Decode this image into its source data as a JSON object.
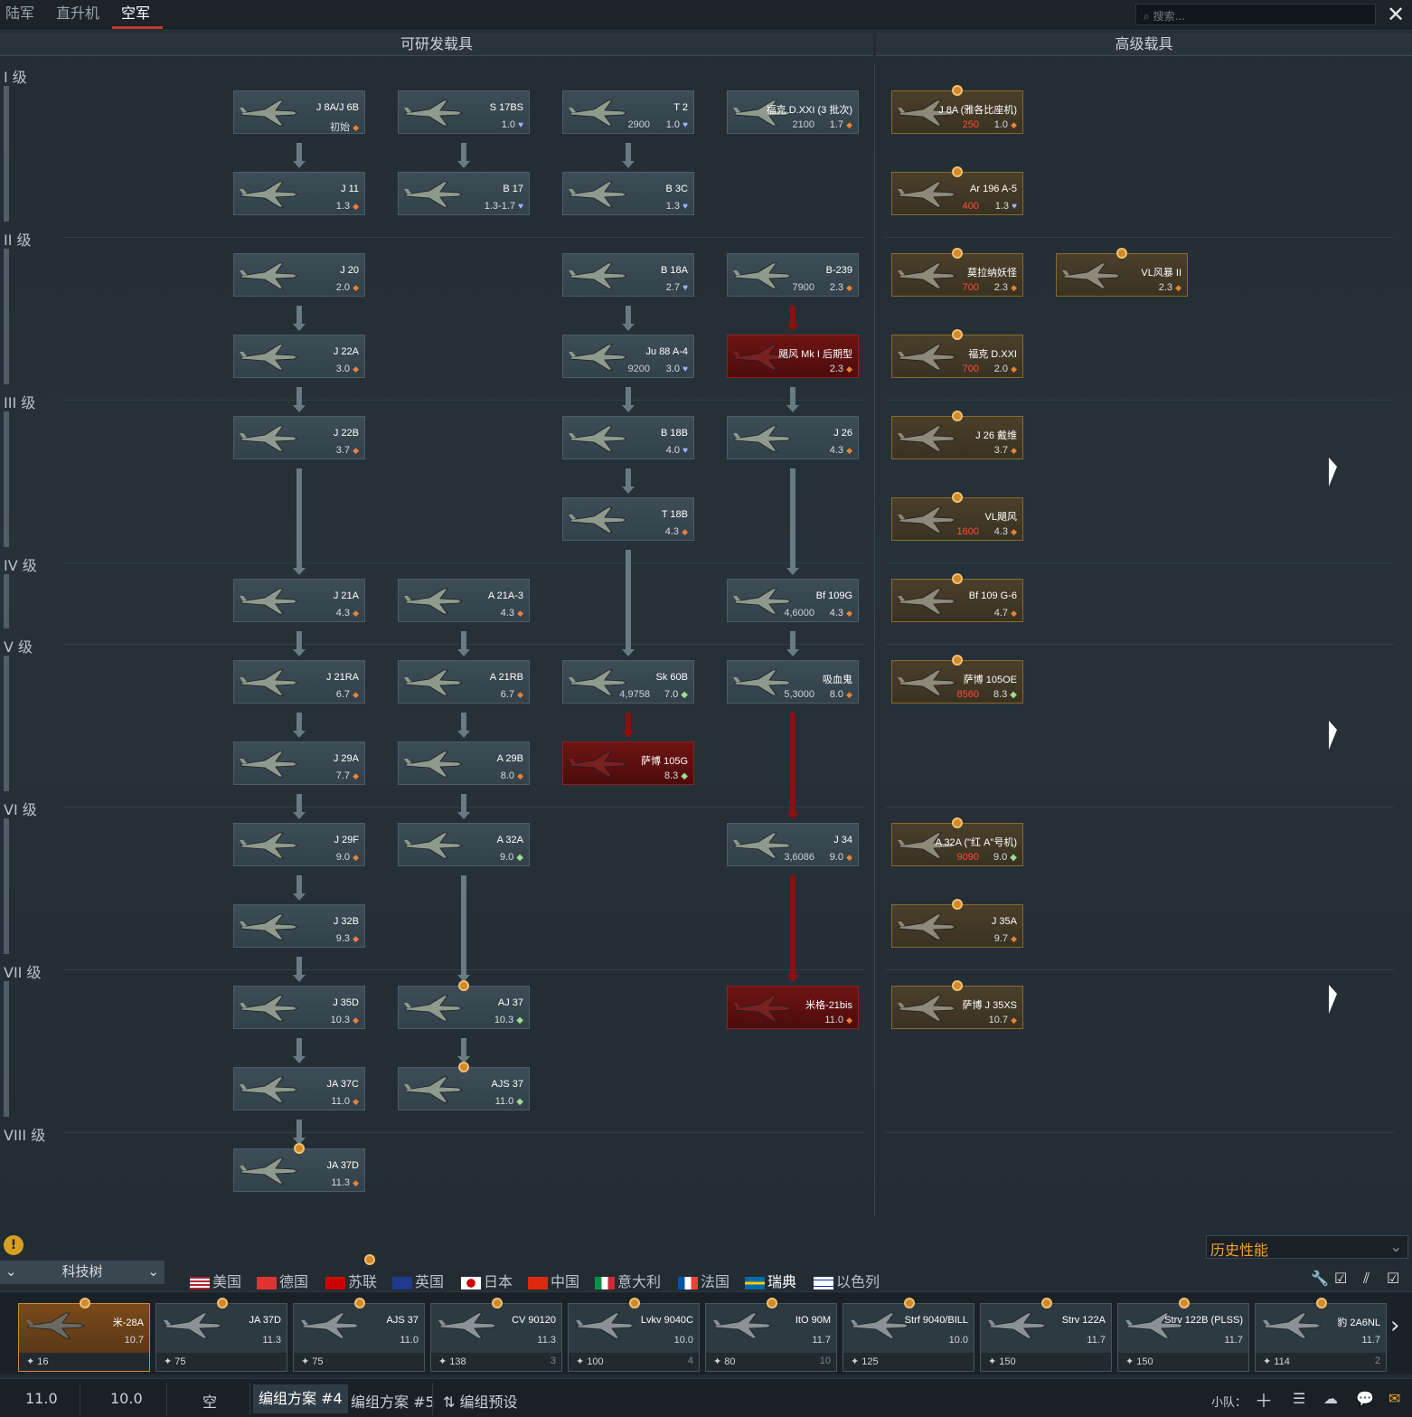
{
  "top_tabs": [
    "陆军",
    "直升机",
    "空军"
  ],
  "search": {
    "placeholder": "搜索..."
  },
  "close_icon": "close-icon",
  "headers": {
    "researchable": "可研发载具",
    "premium": "高级载具"
  },
  "ranks": [
    "I 级",
    "II 级",
    "III 级",
    "IV 级",
    "V 级",
    "VI 级",
    "VII 级",
    "VIII 级"
  ],
  "vehicles": [
    {
      "name": "J 8A/J 6B",
      "cost": "",
      "br": "初始",
      "icon": "dot"
    },
    {
      "name": "S 17BS",
      "cost": "",
      "br": "1.0",
      "icon": "blue"
    },
    {
      "name": "T 2",
      "cost": "2900",
      "br": "1.0",
      "icon": "blue"
    },
    {
      "name": "福克 D.XXI (3 批次)",
      "cost": "2100",
      "br": "1.7",
      "icon": "dot"
    },
    {
      "name": "J 8A (雅各比座机)",
      "cost": "250",
      "br": "1.0",
      "icon": "dot"
    },
    {
      "name": "J 11",
      "cost": "",
      "br": "1.3",
      "icon": "dot"
    },
    {
      "name": "B 17",
      "cost": "",
      "br": "1.3-1.7",
      "icon": "blue"
    },
    {
      "name": "B 3C",
      "cost": "",
      "br": "1.3",
      "icon": "blue"
    },
    {
      "name": "Ar 196 A-5",
      "cost": "400",
      "br": "1.3",
      "icon": "blue"
    },
    {
      "name": "J 20",
      "cost": "",
      "br": "2.0",
      "icon": "dot"
    },
    {
      "name": "B 18A",
      "cost": "",
      "br": "2.7",
      "icon": "blue"
    },
    {
      "name": "B-239",
      "cost": "7900",
      "br": "2.3",
      "icon": "dot"
    },
    {
      "name": "莫拉纳妖怪",
      "cost": "700",
      "br": "2.3",
      "icon": "dot"
    },
    {
      "name": "VL风暴 II",
      "cost": "",
      "br": "2.3",
      "icon": "dot"
    },
    {
      "name": "J 22A",
      "cost": "",
      "br": "3.0",
      "icon": "dot"
    },
    {
      "name": "Ju 88 A-4",
      "cost": "9200",
      "br": "3.0",
      "icon": "blue"
    },
    {
      "name": "飓风 Mk I 后期型",
      "cost": "",
      "br": "2.3",
      "icon": "dot"
    },
    {
      "name": "福克 D.XXI",
      "cost": "700",
      "br": "2.0",
      "icon": "dot"
    },
    {
      "name": "J 22B",
      "cost": "",
      "br": "3.7",
      "icon": "dot"
    },
    {
      "name": "B 18B",
      "cost": "",
      "br": "4.0",
      "icon": "blue"
    },
    {
      "name": "J 26",
      "cost": "",
      "br": "4.3",
      "icon": "dot"
    },
    {
      "name": "J 26 戴维",
      "cost": "",
      "br": "3.7",
      "icon": "dot"
    },
    {
      "name": "T 18B",
      "cost": "",
      "br": "4.3",
      "icon": "dot"
    },
    {
      "name": "VL飓风",
      "cost": "1600",
      "br": "4.3",
      "icon": "dot"
    },
    {
      "name": "J 21A",
      "cost": "",
      "br": "4.3",
      "icon": "dot"
    },
    {
      "name": "A 21A-3",
      "cost": "",
      "br": "4.3",
      "icon": "dot"
    },
    {
      "name": "Bf 109G",
      "cost": "4,6000",
      "br": "4.3",
      "icon": "dot"
    },
    {
      "name": "Bf 109 G-6",
      "cost": "",
      "br": "4.7",
      "icon": "dot"
    },
    {
      "name": "J 21RA",
      "cost": "",
      "br": "6.7",
      "icon": "dot"
    },
    {
      "name": "A 21RB",
      "cost": "",
      "br": "6.7",
      "icon": "dot"
    },
    {
      "name": "Sk 60B",
      "cost": "4,9758",
      "br": "7.0",
      "icon": "green"
    },
    {
      "name": "吸血鬼",
      "cost": "5,3000",
      "br": "8.0",
      "icon": "dot"
    },
    {
      "name": "萨博 105OE",
      "cost": "8560",
      "br": "8.3",
      "icon": "green"
    },
    {
      "name": "J 29A",
      "cost": "",
      "br": "7.7",
      "icon": "dot"
    },
    {
      "name": "A 29B",
      "cost": "",
      "br": "8.0",
      "icon": "dot"
    },
    {
      "name": "萨博 105G",
      "cost": "",
      "br": "8.3",
      "icon": "green"
    },
    {
      "name": "J 29F",
      "cost": "",
      "br": "9.0",
      "icon": "dot"
    },
    {
      "name": "A 32A",
      "cost": "",
      "br": "9.0",
      "icon": "green"
    },
    {
      "name": "J 34",
      "cost": "3,6086",
      "br": "9.0",
      "icon": "dot"
    },
    {
      "name": "A 32A (\"红 A\"号机)",
      "cost": "9090",
      "br": "9.0",
      "icon": "green"
    },
    {
      "name": "J 32B",
      "cost": "",
      "br": "9.3",
      "icon": "dot"
    },
    {
      "name": "J 35A",
      "cost": "",
      "br": "9.7",
      "icon": "dot"
    },
    {
      "name": "J 35D",
      "cost": "",
      "br": "10.3",
      "icon": "dot"
    },
    {
      "name": "AJ 37",
      "cost": "",
      "br": "10.3",
      "icon": "green"
    },
    {
      "name": "米格-21bis",
      "cost": "",
      "br": "11.0",
      "icon": "dot"
    },
    {
      "name": "萨博 J 35XS",
      "cost": "",
      "br": "10.7",
      "icon": "dot"
    },
    {
      "name": "JA 37C",
      "cost": "",
      "br": "11.0",
      "icon": "dot"
    },
    {
      "name": "AJS 37",
      "cost": "",
      "br": "11.0",
      "icon": "green"
    },
    {
      "name": "JA 37D",
      "cost": "",
      "br": "11.3",
      "icon": "dot"
    }
  ],
  "bottom": {
    "tech_tree": "科技树",
    "historical": "历史性能",
    "warning_icon": "warning-icon"
  },
  "nations": [
    "美国",
    "德国",
    "苏联",
    "英国",
    "日本",
    "中国",
    "意大利",
    "法国",
    "瑞典",
    "以色列"
  ],
  "lineup": [
    {
      "name": "米-28A",
      "br": "10.7",
      "foot": "16",
      "foot_r": ""
    },
    {
      "name": "JA 37D",
      "br": "11.3",
      "foot": "75",
      "foot_r": ""
    },
    {
      "name": "AJS 37",
      "br": "11.0",
      "foot": "75",
      "foot_r": ""
    },
    {
      "name": "CV 90120",
      "br": "11.3",
      "foot": "138",
      "foot_r": "3"
    },
    {
      "name": "Lvkv 9040C",
      "br": "10.0",
      "foot": "100",
      "foot_r": "4"
    },
    {
      "name": "ItO 90M",
      "br": "11.7",
      "foot": "80",
      "foot_r": "10"
    },
    {
      "name": "Strf 9040/BILL",
      "br": "10.0",
      "foot": "125",
      "foot_r": ""
    },
    {
      "name": "Strv 122A",
      "br": "11.7",
      "foot": "150",
      "foot_r": ""
    },
    {
      "name": "Strv 122B (PLSS)",
      "br": "11.7",
      "foot": "150",
      "foot_r": ""
    },
    {
      "name": "豹 2A6NL",
      "br": "11.7",
      "foot": "114",
      "foot_r": "2"
    }
  ],
  "bottombar": {
    "br1": "11.0",
    "br2": "10.0",
    "empty": "空",
    "preset4": "编组方案 #4",
    "preset5": "编组方案 #5",
    "presets": "编组预设",
    "squad": "小队："
  }
}
